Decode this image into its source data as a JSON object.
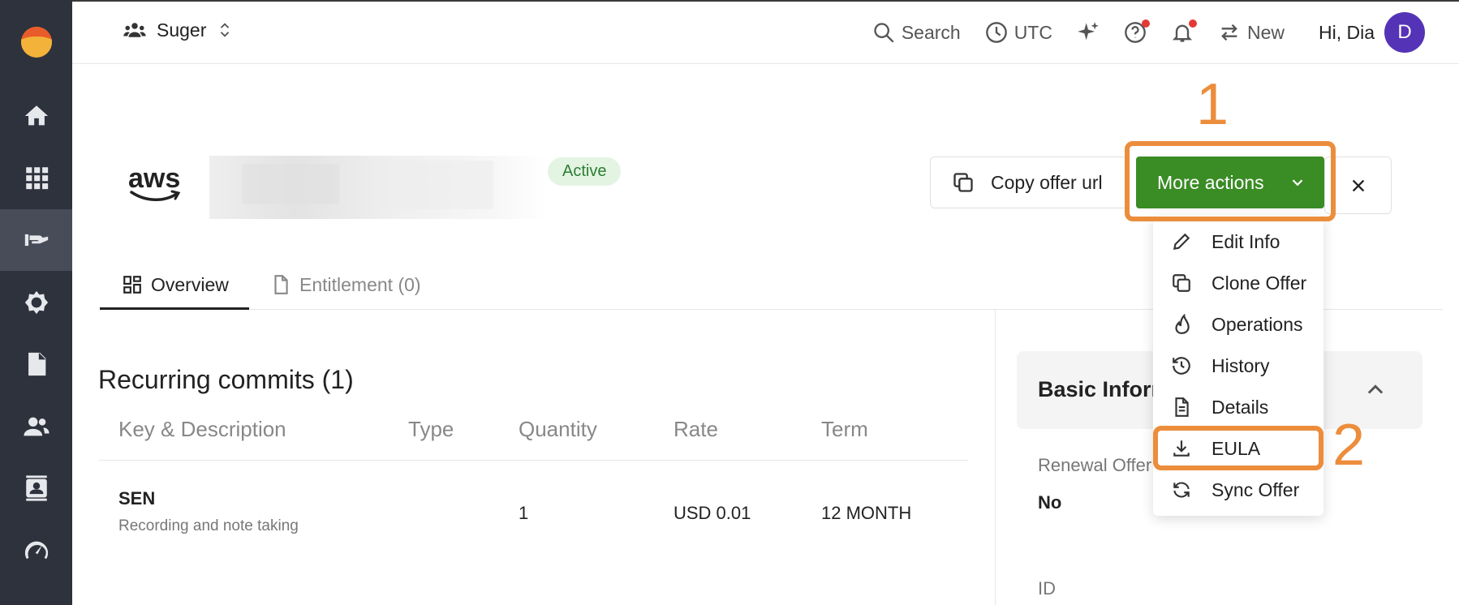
{
  "topbar": {
    "org_name": "Suger",
    "search_label": "Search",
    "timezone": "UTC",
    "new_label": "New",
    "greeting": "Hi, Dia",
    "avatar_initial": "D"
  },
  "sidebar": {
    "items": [
      "home",
      "apps",
      "offers",
      "settings",
      "documents",
      "users",
      "contacts",
      "dashboard"
    ],
    "active": "offers"
  },
  "offer": {
    "provider_logo_text": "aws",
    "status": "Active",
    "copy_url_label": "Copy offer url",
    "more_actions_label": "More actions"
  },
  "tabs": [
    {
      "label": "Overview",
      "active": true
    },
    {
      "label": "Entitlement (0)",
      "active": false
    }
  ],
  "commits": {
    "title": "Recurring commits (1)",
    "columns": [
      "Key & Description",
      "Type",
      "Quantity",
      "Rate",
      "Term"
    ],
    "rows": [
      {
        "key": "SEN",
        "description": "Recording and note taking",
        "type": "",
        "quantity": "1",
        "rate": "USD 0.01",
        "term": "12 MONTH"
      }
    ]
  },
  "basic_info": {
    "title": "Basic Inform",
    "renewal_label": "Renewal Offer",
    "renewal_value": "No",
    "id_label": "ID"
  },
  "menu": {
    "items": [
      "Edit Info",
      "Clone Offer",
      "Operations",
      "History",
      "Details",
      "EULA",
      "Sync Offer"
    ]
  },
  "annotations": {
    "step1": "1",
    "step2": "2",
    "color": "#ec8d3c"
  },
  "colors": {
    "primary_green": "#3a8c25",
    "sidebar_bg": "#2e323d",
    "active_badge_bg": "#e3f4e3",
    "avatar_bg": "#5533b6"
  }
}
